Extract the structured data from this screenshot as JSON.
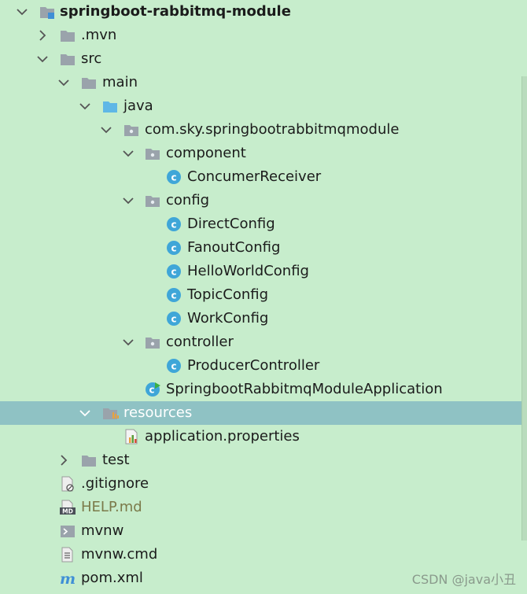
{
  "project_tree": {
    "rows": [
      {
        "label": "springboot-rabbitmq-module",
        "icon": "module-folder-icon"
      },
      {
        "label": ".mvn",
        "icon": "folder-icon"
      },
      {
        "label": "src",
        "icon": "folder-icon"
      },
      {
        "label": "main",
        "icon": "folder-icon"
      },
      {
        "label": "java",
        "icon": "source-root-folder-icon"
      },
      {
        "label": "com.sky.springbootrabbitmqmodule",
        "icon": "package-icon"
      },
      {
        "label": "component",
        "icon": "package-icon"
      },
      {
        "label": "ConcumerReceiver",
        "icon": "java-class-icon"
      },
      {
        "label": "config",
        "icon": "package-icon"
      },
      {
        "label": "DirectConfig",
        "icon": "java-class-icon"
      },
      {
        "label": "FanoutConfig",
        "icon": "java-class-icon"
      },
      {
        "label": "HelloWorldConfig",
        "icon": "java-class-icon"
      },
      {
        "label": "TopicConfig",
        "icon": "java-class-icon"
      },
      {
        "label": "WorkConfig",
        "icon": "java-class-icon"
      },
      {
        "label": "controller",
        "icon": "package-icon"
      },
      {
        "label": "ProducerController",
        "icon": "java-class-icon"
      },
      {
        "label": "SpringbootRabbitmqModuleApplication",
        "icon": "spring-boot-app-class-icon"
      },
      {
        "label": "resources",
        "icon": "resources-folder-icon"
      },
      {
        "label": "application.properties",
        "icon": "properties-file-icon"
      },
      {
        "label": "test",
        "icon": "folder-icon"
      },
      {
        "label": ".gitignore",
        "icon": "ignored-file-icon"
      },
      {
        "label": "HELP.md",
        "icon": "markdown-file-icon"
      },
      {
        "label": "mvnw",
        "icon": "shell-script-icon"
      },
      {
        "label": "mvnw.cmd",
        "icon": "text-file-icon"
      },
      {
        "label": "pom.xml",
        "icon": "maven-file-icon"
      }
    ]
  },
  "watermark": "CSDN @java小丑",
  "colors": {
    "background": "#c7edcc",
    "selected_row": "#8fc2c4",
    "folder_gray": "#9aa3ab",
    "folder_blue": "#5fb7e6",
    "class_circle": "#3fa6d8",
    "muted_text": "#7b7a4a"
  }
}
